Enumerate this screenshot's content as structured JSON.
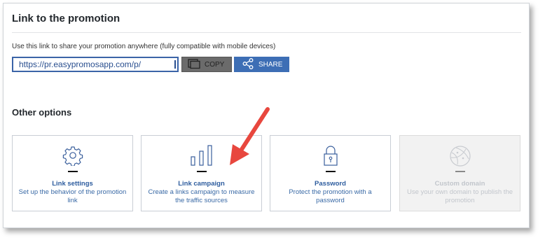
{
  "section": {
    "title": "Link to the promotion",
    "description": "Use this link to share your promotion anywhere (fully compatible with mobile devices)",
    "url_value": "https://pr.easypromosapp.com/p/",
    "copy_label": "COPY",
    "share_label": "SHARE"
  },
  "options": {
    "title": "Other options",
    "cards": [
      {
        "title": "Link settings",
        "subtitle": "Set up the behavior of the promotion link",
        "icon": "gear-icon",
        "enabled": true
      },
      {
        "title": "Link campaign",
        "subtitle": "Create a links campaign to measure the traffic sources",
        "icon": "bar-chart-icon",
        "enabled": true
      },
      {
        "title": "Password",
        "subtitle": "Protect the promotion with a password",
        "icon": "lock-icon",
        "enabled": true
      },
      {
        "title": "Custom domain",
        "subtitle": "Use your own domain to publish the promotion",
        "icon": "globe-icon",
        "enabled": false
      }
    ]
  },
  "colors": {
    "accent": "#3d6eb5",
    "link_text": "#2d5c9e",
    "annotation_arrow": "#e8473e"
  }
}
